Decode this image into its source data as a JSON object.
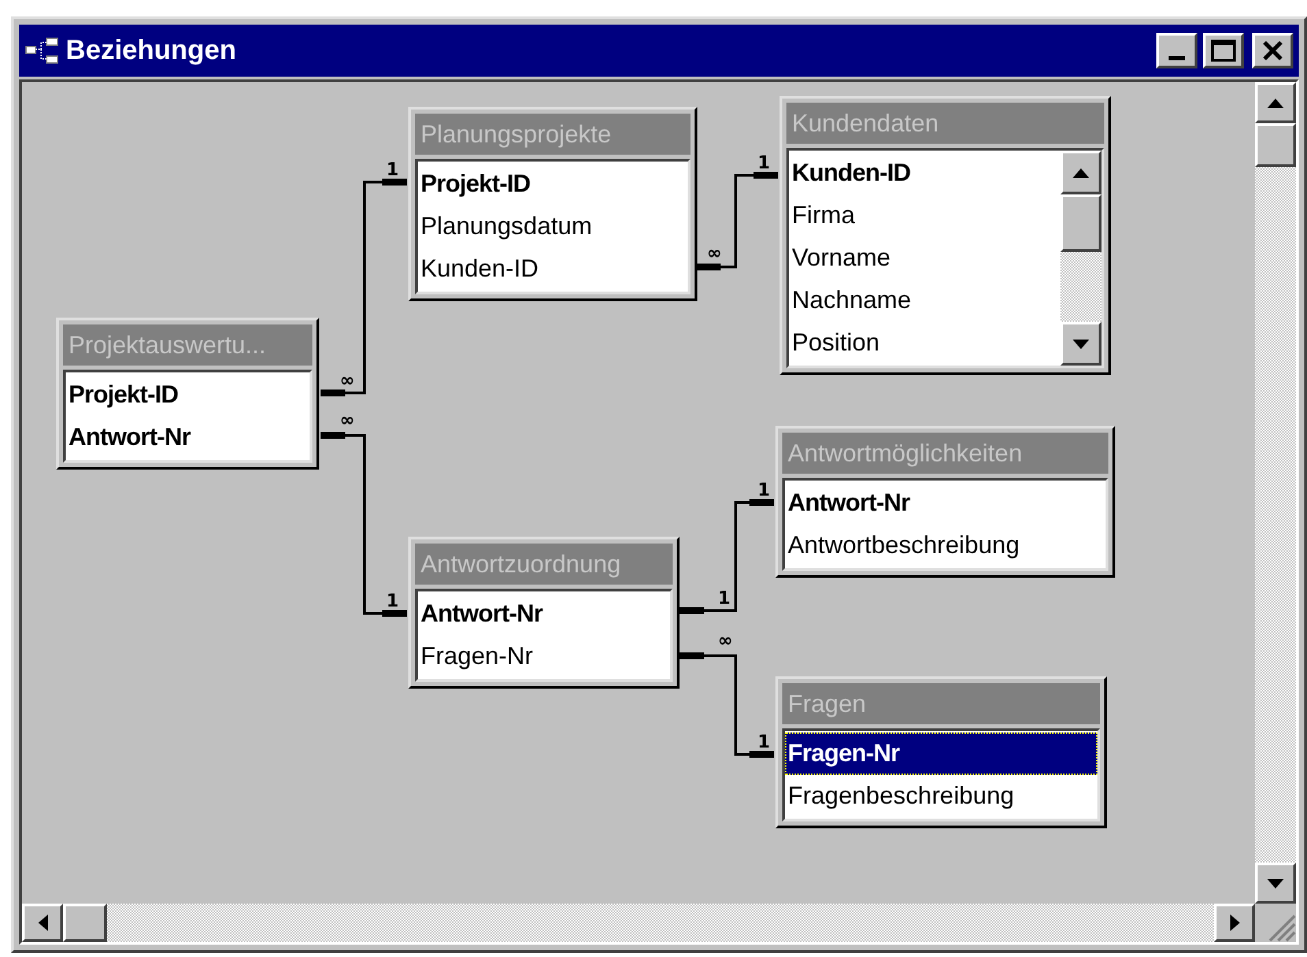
{
  "window": {
    "title": "Beziehungen"
  },
  "tables": [
    {
      "title": "Planungsprojekte",
      "fields": [
        {
          "name": "Projekt-ID",
          "key": true,
          "selected": false
        },
        {
          "name": "Planungsdatum",
          "key": false,
          "selected": false
        },
        {
          "name": "Kunden-ID",
          "key": false,
          "selected": false
        }
      ]
    },
    {
      "title": "Kundendaten",
      "has_scrollbar": true,
      "fields": [
        {
          "name": "Kunden-ID",
          "key": true,
          "selected": false
        },
        {
          "name": "Firma",
          "key": false,
          "selected": false
        },
        {
          "name": "Vorname",
          "key": false,
          "selected": false
        },
        {
          "name": "Nachname",
          "key": false,
          "selected": false
        },
        {
          "name": "Position",
          "key": false,
          "selected": false
        }
      ]
    },
    {
      "title": "Projektauswertu...",
      "fields": [
        {
          "name": "Projekt-ID",
          "key": true,
          "selected": false
        },
        {
          "name": "Antwort-Nr",
          "key": true,
          "selected": false
        }
      ]
    },
    {
      "title": "Antwortmöglichkeiten",
      "fields": [
        {
          "name": "Antwort-Nr",
          "key": true,
          "selected": false
        },
        {
          "name": "Antwortbeschreibung",
          "key": false,
          "selected": false
        }
      ]
    },
    {
      "title": "Antwortzuordnung",
      "fields": [
        {
          "name": "Antwort-Nr",
          "key": true,
          "selected": false
        },
        {
          "name": "Fragen-Nr",
          "key": false,
          "selected": false
        }
      ]
    },
    {
      "title": "Fragen",
      "fields": [
        {
          "name": "Fragen-Nr",
          "key": true,
          "selected": true
        },
        {
          "name": "Fragenbeschreibung",
          "key": false,
          "selected": false
        }
      ]
    }
  ],
  "relationships": [
    {
      "from_mark": "∞",
      "to_mark": "1"
    },
    {
      "from_mark": "∞",
      "to_mark": "1"
    },
    {
      "from_mark": "∞",
      "to_mark": "1"
    },
    {
      "from_mark": "1",
      "to_mark": "1"
    },
    {
      "from_mark": "∞",
      "to_mark": "1"
    }
  ]
}
